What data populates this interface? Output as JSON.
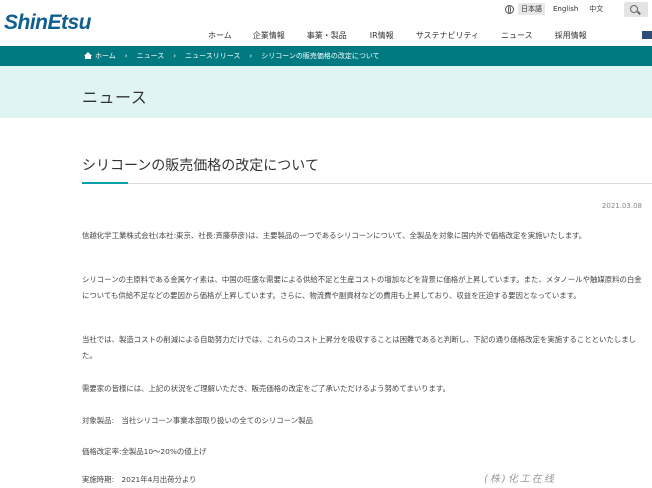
{
  "brand": {
    "logo_text": "ShinEtsu"
  },
  "util_nav": {
    "lang_ja": "日本語",
    "lang_en": "English",
    "lang_zh": "中文"
  },
  "main_nav": [
    "ホーム",
    "企業情報",
    "事業・製品",
    "IR情報",
    "サステナビリティ",
    "ニュース",
    "採用情報"
  ],
  "breadcrumb": [
    "ホーム",
    "ニュース",
    "ニュースリリース",
    "シリコーンの販売価格の改定について"
  ],
  "page_heading": "ニュース",
  "article": {
    "title": "シリコーンの販売価格の改定について",
    "date": "2021.03.08",
    "paragraphs": [
      "信越化学工業株式会社(本社:東京、社長:斉藤恭彦)は、主要製品の一つであるシリコーンについて、全製品を対象に国内外で価格改定を実施いたします。",
      "シリコーンの主原料である金属ケイ素は、中国の旺盛な需要による供給不足と生産コストの増加などを背景に価格が上昇しています。また、メタノールや触媒原料の白金についても供給不足などの要因から価格が上昇しています。さらに、物流費や副資材などの費用も上昇しており、収益を圧迫する要因となっています。",
      "当社では、製造コストの削減による自助努力だけでは、これらのコスト上昇分を吸収することは困難であると判断し、下記の通り価格改定を実施することといたしました。",
      "需要家の皆様には、上記の状況をご理解いただき、販売価格の改定をご了承いただけるよう努めてまいります。",
      "対象製品:　当社シリコーン事業本部取り扱いの全てのシリコーン製品",
      "価格改定率:全製品10～20%の値上げ",
      "実施時期:　2021年4月出荷分より"
    ]
  },
  "watermark": "(株)化工在线"
}
